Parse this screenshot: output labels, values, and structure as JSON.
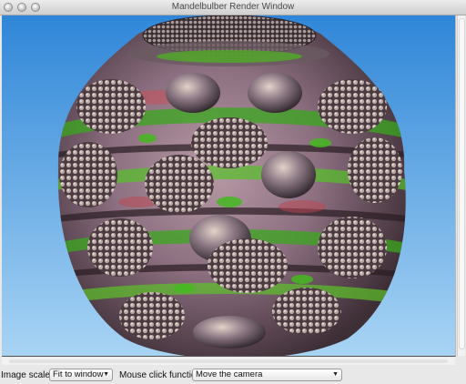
{
  "window": {
    "title": "Mandelbulber Render Window"
  },
  "controls": {
    "image_scale_label": "Image scale:",
    "image_scale_value": "Fit to window",
    "mouse_click_label": "Mouse click function:",
    "mouse_click_value": "Move the camera"
  },
  "icons": {
    "dropdown": "triangle-down-icon"
  },
  "colors": {
    "sky_top": "#2f86d8",
    "sky_bottom": "#a8d4f4",
    "fractal_green": "#3aa81e",
    "fractal_purple": "#9a7c8e"
  }
}
